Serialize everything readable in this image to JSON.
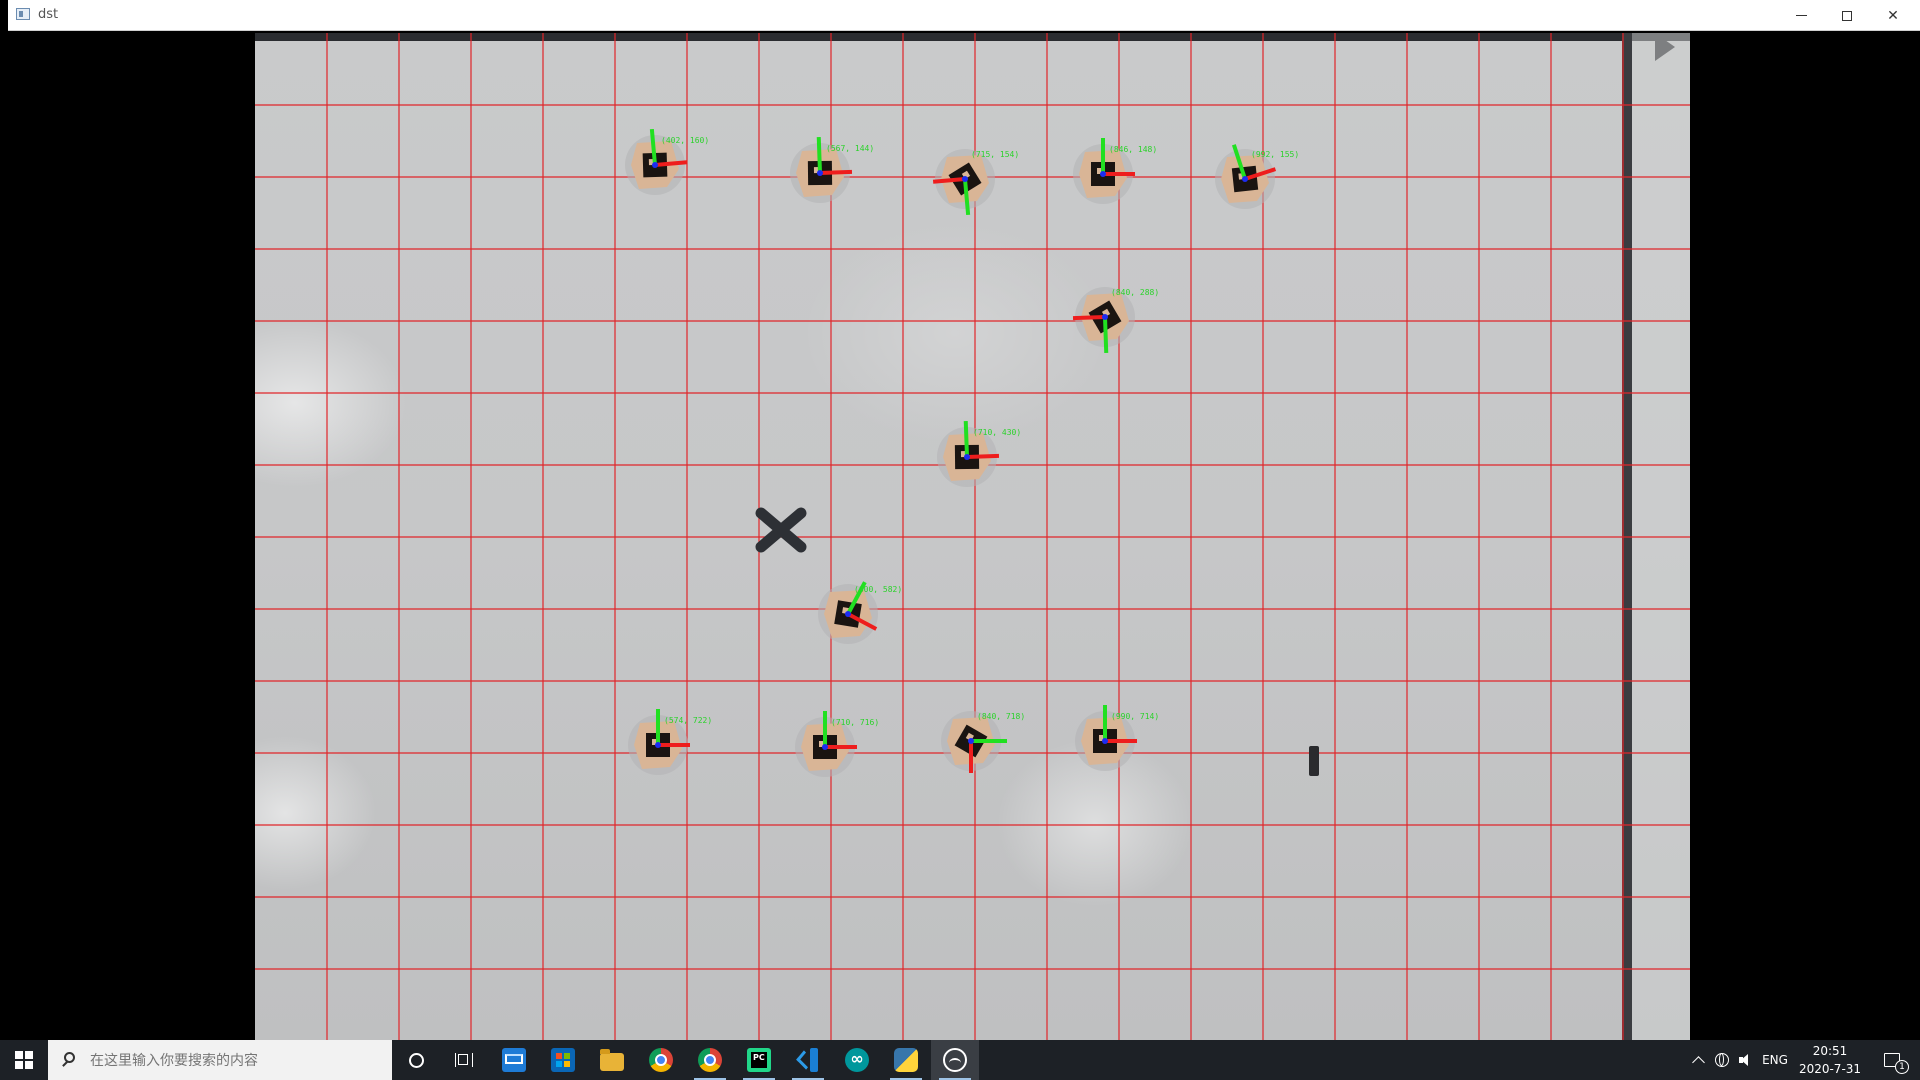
{
  "window": {
    "title": "dst",
    "icon": "opencv-window-icon",
    "controls": [
      "minimize",
      "maximize",
      "close"
    ]
  },
  "canvas": {
    "grid_color": "#e0262a",
    "grid_spacing": 72,
    "axis_colors": {
      "x": "#ee1d1d",
      "y": "#21e021",
      "z": "#1c2cf2"
    },
    "markers": [
      {
        "label": "(402, 160)"
      },
      {
        "label": "(567, 144)"
      },
      {
        "label": "(715, 154)"
      },
      {
        "label": "(846, 148)"
      },
      {
        "label": "(992, 155)"
      },
      {
        "label": "(840, 288)"
      },
      {
        "label": "(710, 430)"
      },
      {
        "label": "(600, 582)"
      },
      {
        "label": "(574, 722)"
      },
      {
        "label": "(710, 716)"
      },
      {
        "label": "(840, 718)"
      },
      {
        "label": "(990, 714)"
      }
    ]
  },
  "taskbar": {
    "search_placeholder": "在这里输入你要搜索的内容",
    "apps": [
      {
        "name": "mail",
        "icon": "mail-icon"
      },
      {
        "name": "store",
        "icon": "store-icon"
      },
      {
        "name": "file-explorer",
        "icon": "folder-icon"
      },
      {
        "name": "chrome",
        "icon": "chrome-icon"
      },
      {
        "name": "chrome-2",
        "icon": "chrome-icon"
      },
      {
        "name": "pycharm",
        "icon": "pycharm-icon",
        "text": "PC"
      },
      {
        "name": "vscode",
        "icon": "vscode-icon"
      },
      {
        "name": "arduino",
        "icon": "arduino-icon"
      },
      {
        "name": "python",
        "icon": "python-icon"
      },
      {
        "name": "photos",
        "icon": "photos-icon"
      }
    ],
    "tray": {
      "language": "ENG",
      "time": "20:51",
      "date": "2020-7-31",
      "notification_count": "1"
    }
  }
}
